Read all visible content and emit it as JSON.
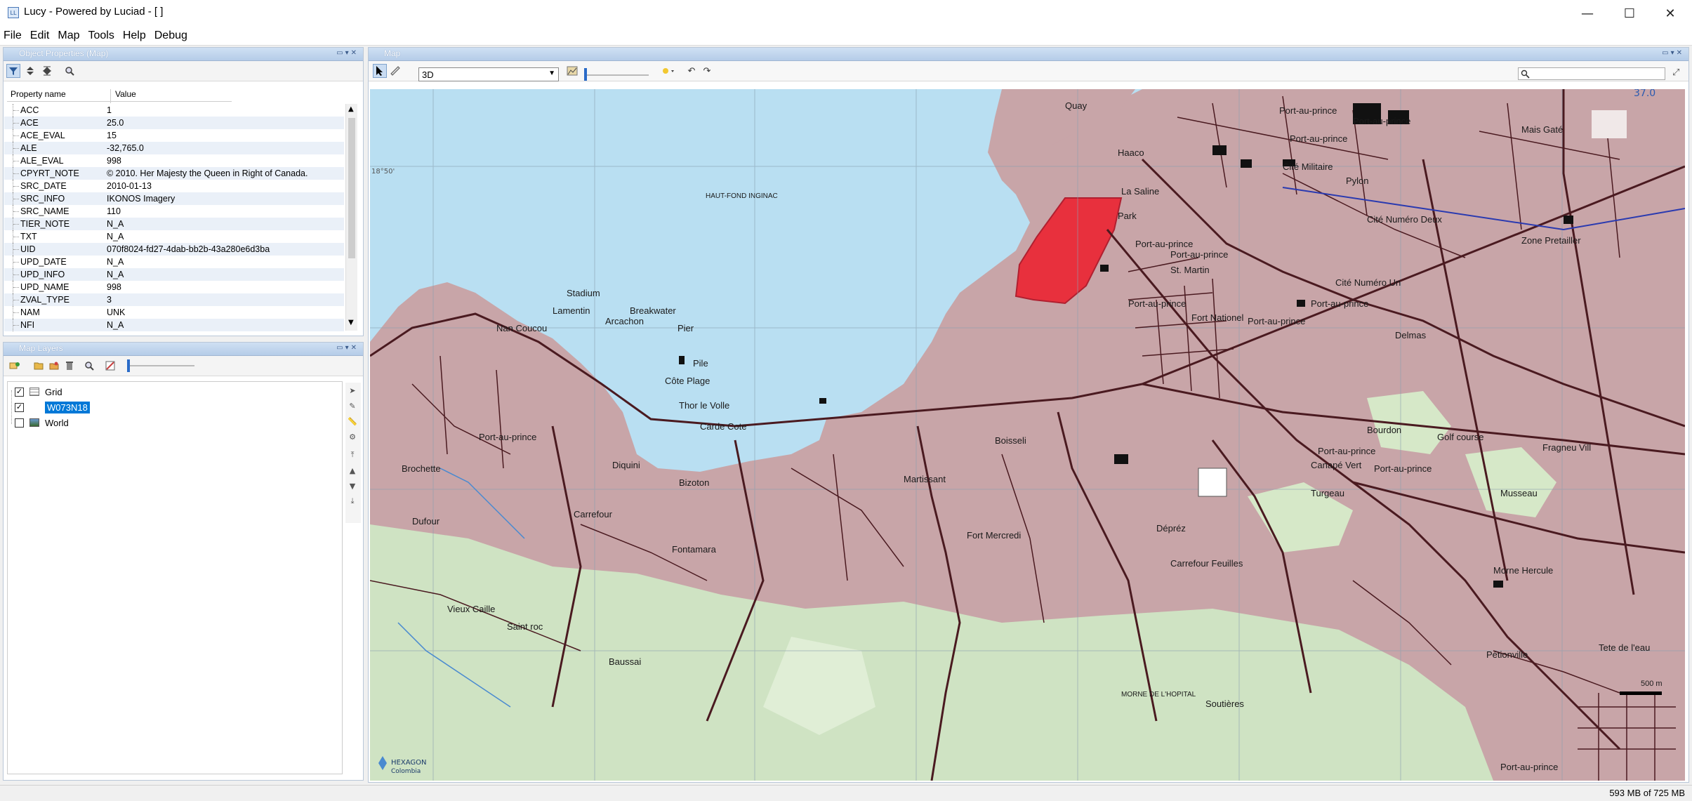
{
  "window": {
    "title": "Lucy - Powered by Luciad - [ ]",
    "icon": "lucy-app-icon",
    "controls": {
      "minimize": "—",
      "maximize": "☐",
      "close": "✕"
    }
  },
  "menu": [
    "File",
    "Edit",
    "Map",
    "Tools",
    "Help",
    "Debug"
  ],
  "properties_panel": {
    "title": "Object Properties (Map)",
    "columns": {
      "name": "Property name",
      "value": "Value"
    },
    "rows": [
      {
        "name": "ACC",
        "value": "1"
      },
      {
        "name": "ACE",
        "value": "25.0"
      },
      {
        "name": "ACE_EVAL",
        "value": "15"
      },
      {
        "name": "ALE",
        "value": "-32,765.0"
      },
      {
        "name": "ALE_EVAL",
        "value": "998"
      },
      {
        "name": "CPYRT_NOTE",
        "value": "© 2010. Her Majesty the Queen in Right of Canada."
      },
      {
        "name": "SRC_DATE",
        "value": "2010-01-13"
      },
      {
        "name": "SRC_INFO",
        "value": "IKONOS Imagery"
      },
      {
        "name": "SRC_NAME",
        "value": "110"
      },
      {
        "name": "TIER_NOTE",
        "value": "N_A"
      },
      {
        "name": "TXT",
        "value": "N_A"
      },
      {
        "name": "UID",
        "value": "070f8024-fd27-4dab-bb2b-43a280e6d3ba"
      },
      {
        "name": "UPD_DATE",
        "value": "N_A"
      },
      {
        "name": "UPD_INFO",
        "value": "N_A"
      },
      {
        "name": "UPD_NAME",
        "value": "998"
      },
      {
        "name": "ZVAL_TYPE",
        "value": "3"
      },
      {
        "name": "NAM",
        "value": "UNK"
      },
      {
        "name": "NFI",
        "value": "N_A"
      }
    ]
  },
  "layers_panel": {
    "title": "Map Layers",
    "layers": [
      {
        "name": "Grid",
        "checked": true,
        "selected": false
      },
      {
        "name": "W073N18",
        "checked": true,
        "selected": true
      },
      {
        "name": "World",
        "checked": false,
        "selected": false
      }
    ]
  },
  "map_panel": {
    "title": "Map",
    "view_mode": "3D",
    "scale_label": "37.0",
    "attribution": "HEXAGON",
    "attribution_sub": "Colombia",
    "scale_bar": "500 m",
    "grid_label": "18°50'",
    "labels": [
      "Quay",
      "HAUT-FOND INGINAC",
      "Haaco",
      "Port-au-prince",
      "Port-au-prince",
      "Mais Gaté",
      "Port-au-prince",
      "Cité Militaire",
      "Pylon",
      "La Saline",
      "Park",
      "Port-au-prince",
      "Cité Numéro Deux",
      "Zone Pretailler",
      "Port-au-prince",
      "St. Martin",
      "Cité Numéro Un",
      "Port-au-prince",
      "Fort Nationel",
      "Port-au-prince",
      "Delmas",
      "Breakwater",
      "Pier",
      "Pile",
      "Port-au-prince",
      "Bourdon",
      "Golf course",
      "Fragneu Vill",
      "Lamentin",
      "Arcachon",
      "Stadium",
      "Nan Coucou",
      "Côte Plage",
      "Thor le Volle",
      "Carde Cote",
      "Port-au-prince",
      "Boisseli",
      "Port-au-prince",
      "Canapé Vert",
      "Port-au-prince",
      "Brochette",
      "Diquini",
      "Bizoton",
      "Martissant",
      "Turgeau",
      "Musseau",
      "Dufour",
      "Carrefour",
      "Fort Mercredi",
      "Dépréz",
      "Fontamara",
      "Carrefour Feuilles",
      "Morne Hercule",
      "Vieux Caille",
      "Saint roc",
      "Pétionville",
      "Baussai",
      "MORNE DE L'HOPITAL",
      "Soutières",
      "Tete de l'eau",
      "Port-au-prince"
    ]
  },
  "status": {
    "memory": "593 MB of 725 MB"
  },
  "colors": {
    "land": "#c8a5a8",
    "water": "#b9dff2",
    "road": "#4a1a20",
    "vegetation": "#cfe3c3",
    "highlight": "#e8303d",
    "panel_header": "#b5cce8",
    "selection": "#0078d7"
  }
}
